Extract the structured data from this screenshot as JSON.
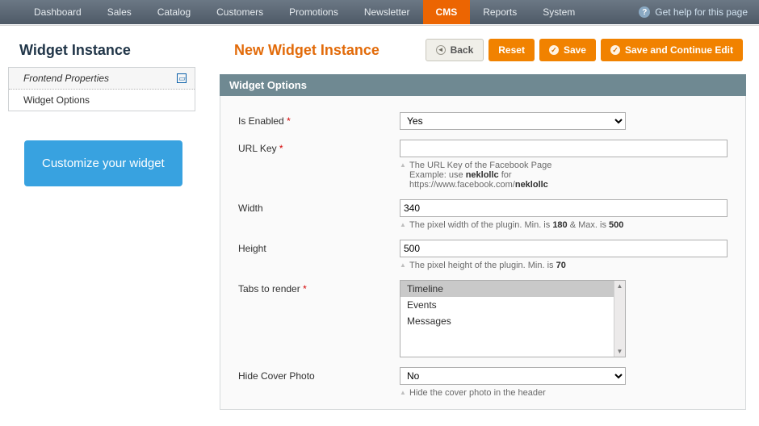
{
  "nav": {
    "items": [
      "Dashboard",
      "Sales",
      "Catalog",
      "Customers",
      "Promotions",
      "Newsletter",
      "CMS",
      "Reports",
      "System"
    ],
    "active_index": 6,
    "help": "Get help for this page"
  },
  "sidebar": {
    "title": "Widget Instance",
    "tabs": [
      {
        "label": "Frontend Properties",
        "active": true
      },
      {
        "label": "Widget Options",
        "active": false
      }
    ],
    "promo": "Customize your widget"
  },
  "header": {
    "title": "New Widget Instance",
    "buttons": {
      "back": "Back",
      "reset": "Reset",
      "save": "Save",
      "save_continue": "Save and Continue Edit"
    }
  },
  "section": {
    "title": "Widget Options"
  },
  "form": {
    "is_enabled": {
      "label": "Is Enabled",
      "value": "Yes"
    },
    "url_key": {
      "label": "URL Key",
      "value": "",
      "hint_pre": "The URL Key of the Facebook Page",
      "hint_ex_pre": "Example: use ",
      "hint_ex_bold": "neklollc",
      "hint_ex_post": " for",
      "hint_ex_url_pre": "https://www.facebook.com/",
      "hint_ex_url_bold": "neklollc"
    },
    "width": {
      "label": "Width",
      "value": "340",
      "hint_pre": "The pixel width of the plugin. Min. is ",
      "hint_min": "180",
      "hint_mid": " & Max. is ",
      "hint_max": "500"
    },
    "height": {
      "label": "Height",
      "value": "500",
      "hint_pre": "The pixel height of the plugin. Min. is ",
      "hint_min": "70"
    },
    "tabs": {
      "label": "Tabs to render",
      "options": [
        "Timeline",
        "Events",
        "Messages"
      ],
      "selected_index": 0
    },
    "hide_cover": {
      "label": "Hide Cover Photo",
      "value": "No",
      "hint": "Hide the cover photo in the header"
    }
  }
}
